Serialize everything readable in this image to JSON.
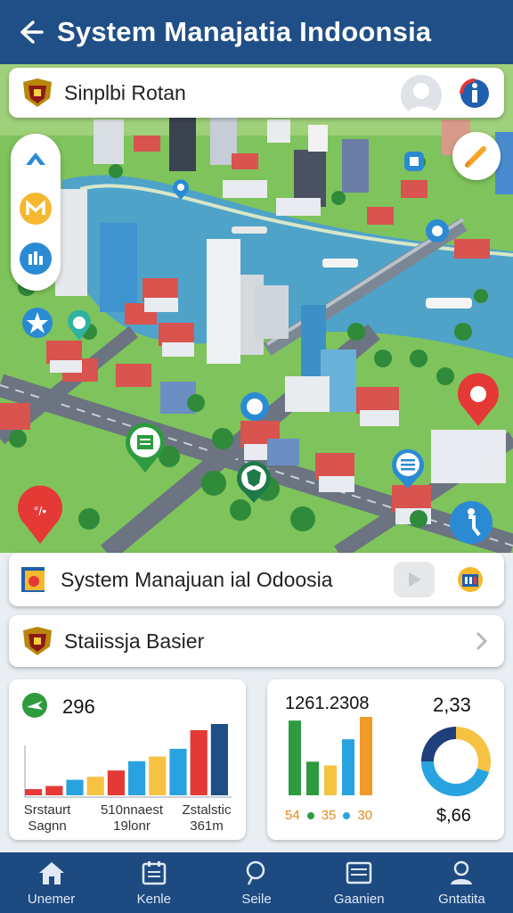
{
  "header": {
    "title": "System Manajatia Indoonsia"
  },
  "top_card": {
    "label": "Sinplbi Rotan"
  },
  "mid_card": {
    "label": "System Manajuan ial Odoosia"
  },
  "stat_card": {
    "label": "Staiissja Basier"
  },
  "stats_left": {
    "value": "296",
    "labels": [
      {
        "line1": "Srstaurt",
        "line2": "Sagnn"
      },
      {
        "line1": "510nnaest",
        "line2": "19lonr"
      },
      {
        "line1": "Zstalstic",
        "line2": "361m"
      }
    ],
    "chart_data": {
      "type": "bar",
      "values": [
        4,
        6,
        10,
        12,
        16,
        22,
        25,
        30,
        42,
        46
      ],
      "colors": [
        "#e53935",
        "#e53935",
        "#29a3e0",
        "#f5c242",
        "#e53935",
        "#29a3e0",
        "#f5c242",
        "#29a3e0",
        "#e53935",
        "#1f4f86"
      ]
    }
  },
  "stats_right": {
    "value_a": "1261.2308",
    "value_b": "2,33",
    "legend": [
      {
        "text": "54",
        "color": "#f5c242"
      },
      {
        "text": "35",
        "color": "#f5c242"
      },
      {
        "text": "30",
        "color": "#e08a1a"
      }
    ],
    "donut_value": "$,66",
    "chart_data": [
      {
        "type": "bar",
        "values": [
          40,
          18,
          16,
          30,
          42
        ],
        "colors": [
          "#2e9b3e",
          "#2e9b3e",
          "#f5c242",
          "#29a3e0",
          "#f09a2a"
        ]
      },
      {
        "type": "pie",
        "values": [
          30,
          45,
          25
        ],
        "colors": [
          "#f5c242",
          "#29a3e0",
          "#1f3f7a"
        ]
      }
    ]
  },
  "nav": {
    "items": [
      {
        "label": "Unemer",
        "icon": "home-icon"
      },
      {
        "label": "Kenle",
        "icon": "calendar-icon"
      },
      {
        "label": "Seile",
        "icon": "search-icon"
      },
      {
        "label": "Gaanien",
        "icon": "list-icon"
      },
      {
        "label": "Gntatita",
        "icon": "profile-icon"
      }
    ]
  },
  "colors": {
    "header": "#1f4f86",
    "nav": "#1d4a80"
  }
}
